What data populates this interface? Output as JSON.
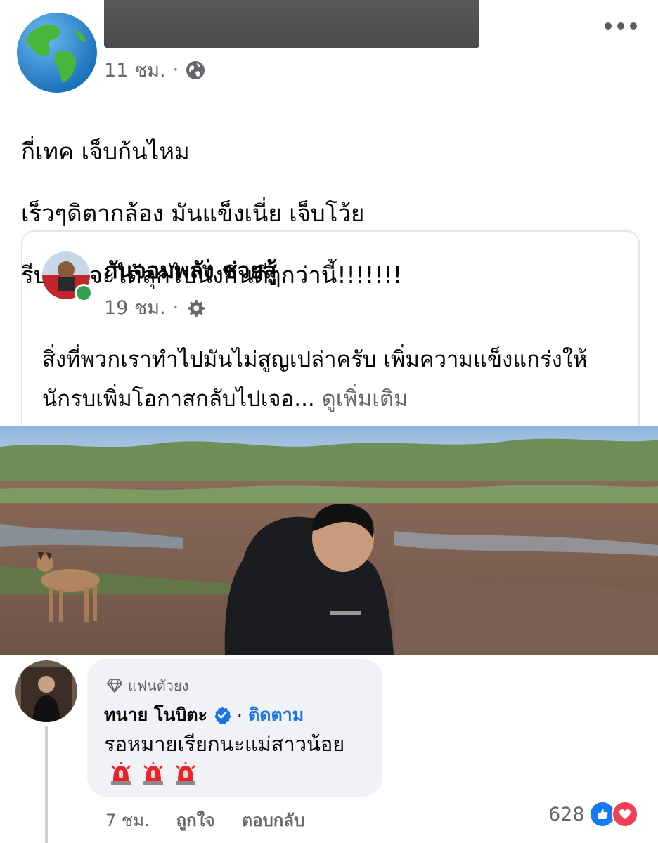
{
  "post": {
    "time": "11 ชม.",
    "separator": "·",
    "lines": [
      "กี่เทค เจ็บก้นไหม",
      "เร็วๆดิตากล้อง มันแข็งเนี่ย เจ็บโว้ย",
      "รีบถ่ายจะได้ลุกไปนั่งกินดีๆกว่านี้!!!!!!!"
    ]
  },
  "shared": {
    "name": "กันจอมพลัง ช่วยสู้",
    "time": "19 ชม.",
    "separator": "·",
    "text": "สิ่งที่พวกเราทำไปมันไม่สูญเปล่าครับ เพิ่มความแข็งแกร่งให้นักรบเพิ่มโอกาสกลับไปเจอ...",
    "see_more": "ดูเพิ่มเติม"
  },
  "comment": {
    "badge": "แฟนตัวยง",
    "name": "ทนาย โนบิตะ",
    "separator": "·",
    "follow": "ติดตาม",
    "text": "รอหมายเรียกนะแม่สาวน้อย",
    "time": "7 ชม.",
    "like_label": "ถูกใจ",
    "reply_label": "ตอบกลับ",
    "reaction_count": "628"
  },
  "colors": {
    "link": "#1b74e4",
    "meta": "#65676b",
    "bubble": "#f0f2f5"
  },
  "icons": [
    "globe-icon",
    "gear-icon",
    "more-icon",
    "diamond-icon",
    "verified-icon",
    "siren-icon",
    "like-icon",
    "love-icon"
  ]
}
